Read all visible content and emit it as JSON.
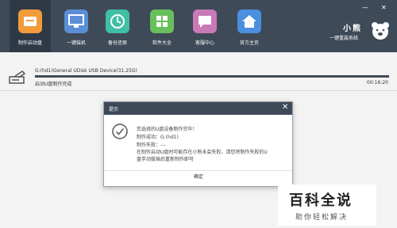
{
  "toolbar": {
    "items": [
      {
        "label": "制作启动盘",
        "icon": "usb-drive-icon",
        "color": "#f29b3b",
        "active": true
      },
      {
        "label": "一键装机",
        "icon": "monitor-icon",
        "color": "#5a8fd6",
        "active": false
      },
      {
        "label": "备份还原",
        "icon": "restore-icon",
        "color": "#3fbfa5",
        "active": false
      },
      {
        "label": "软件大全",
        "icon": "apps-grid-icon",
        "color": "#68c05a",
        "active": false
      },
      {
        "label": "客服中心",
        "icon": "chat-icon",
        "color": "#c979b8",
        "active": false
      },
      {
        "label": "官方主页",
        "icon": "home-icon",
        "color": "#4a8fe0",
        "active": false
      }
    ]
  },
  "window_controls": {
    "minimize": "—",
    "close": "✕"
  },
  "brand": {
    "name": "小熊",
    "slogan": "一键重装系统",
    "logo_icon": "bear-logo-icon"
  },
  "device": {
    "name": "G:(hd1)General UDisk USB Device(31.25G)",
    "status": "启动U盘制作完成",
    "elapsed": "00:16:20",
    "progress_percent": 100
  },
  "dialog": {
    "title": "提示",
    "close": "✕",
    "lines": [
      "您选择的U盘设备制作完毕！",
      "制作成功：G:(hd1)",
      "制作失败：---",
      "在制作启动U盘时可能存在小熊未会失败，请您将制作失败的U",
      "盘手动拔插后重新制作即可"
    ],
    "ok_label": "确定",
    "icon": "check-circle-icon"
  },
  "watermark": {
    "title": "百科全说",
    "subtitle": "助你轻松解决"
  },
  "colors": {
    "topbar": "#3f4a58",
    "accent_dark": "#3e4a58",
    "background": "#f3f3f3"
  }
}
